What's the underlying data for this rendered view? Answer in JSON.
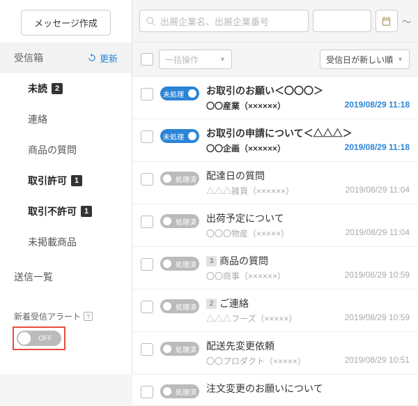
{
  "sidebar": {
    "compose": "メッセージ作成",
    "inbox": "受信箱",
    "refresh": "更新",
    "items": [
      {
        "label": "未読",
        "count": "2",
        "bold": true
      },
      {
        "label": "連絡",
        "bold": false
      },
      {
        "label": "商品の質問",
        "bold": false
      },
      {
        "label": "取引許可",
        "count": "1",
        "bold": true
      },
      {
        "label": "取引不許可",
        "count": "1",
        "bold": true
      },
      {
        "label": "未掲載商品",
        "bold": false
      }
    ],
    "sent": "送信一覧",
    "alert_label": "新着受信アラート",
    "toggle": "OFF"
  },
  "filters": {
    "search_placeholder": "出展企業名、出展企業番号",
    "tilde": "〜"
  },
  "toolbar": {
    "bulk": "一括操作",
    "sort": "受信日が新しい順"
  },
  "status": {
    "unprocessed": "未処理",
    "processed": "処理済"
  },
  "messages": [
    {
      "status": "unprocessed",
      "subject": "お取引のお願い＜〇〇〇＞",
      "from": "〇〇産業（××××××）",
      "date": "2019/08/29 11:18",
      "unread": true
    },
    {
      "status": "unprocessed",
      "subject": "お取引の申請について＜△△△＞",
      "from": "〇〇企画（××××××）",
      "date": "2019/08/29 11:18",
      "unread": true
    },
    {
      "status": "processed",
      "subject": "配達日の質問",
      "from": "△△△雑貨（××××××）",
      "date": "2019/08/29 11:04"
    },
    {
      "status": "processed",
      "subject": "出荷予定について",
      "from": "〇〇〇物産（×××××）",
      "date": "2019/08/29 11:04"
    },
    {
      "status": "processed",
      "subject": "商品の質問",
      "badge": "3",
      "from": "〇〇商事（××××××）",
      "date": "2019/08/29 10:59"
    },
    {
      "status": "processed",
      "subject": "ご連絡",
      "badge": "2",
      "from": "△△△フーズ（×××××）",
      "date": "2019/08/29 10:59"
    },
    {
      "status": "processed",
      "subject": "配送先変更依頼",
      "from": "〇〇プロダクト（×××××）",
      "date": "2019/08/29 10:51"
    },
    {
      "status": "processed",
      "subject": "注文変更のお願いについて",
      "from": "",
      "date": ""
    }
  ]
}
